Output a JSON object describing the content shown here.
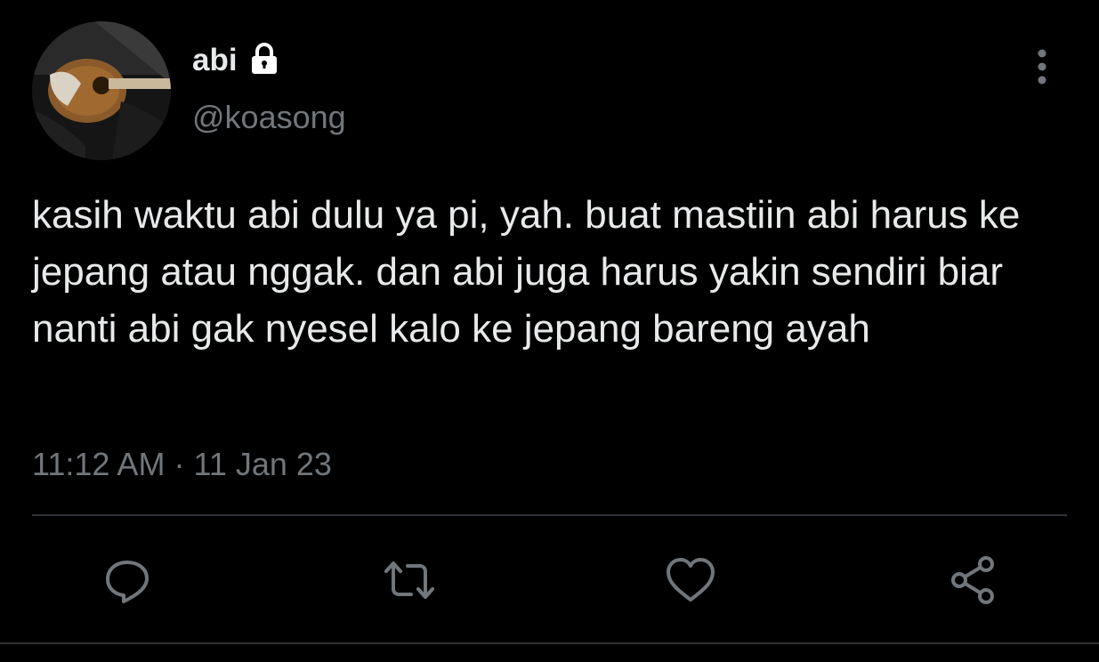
{
  "tweet": {
    "display_name": "abi",
    "handle": "@koasong",
    "text": "kasih waktu abi dulu ya pi, yah. buat mastiin abi harus ke jepang atau nggak. dan abi juga harus yakin sendiri biar nanti abi gak nyesel kalo ke jepang bareng ayah",
    "time": "11:12 AM",
    "separator": "·",
    "date": "11 Jan 23"
  },
  "icons": {
    "lock": "lock-icon",
    "more": "more-vertical-icon",
    "reply": "reply-icon",
    "retweet": "retweet-icon",
    "like": "heart-icon",
    "share": "share-icon"
  },
  "colors": {
    "background": "#000000",
    "primary_text": "#e7e9ea",
    "secondary_text": "#71767b",
    "divider": "#2f3336"
  }
}
